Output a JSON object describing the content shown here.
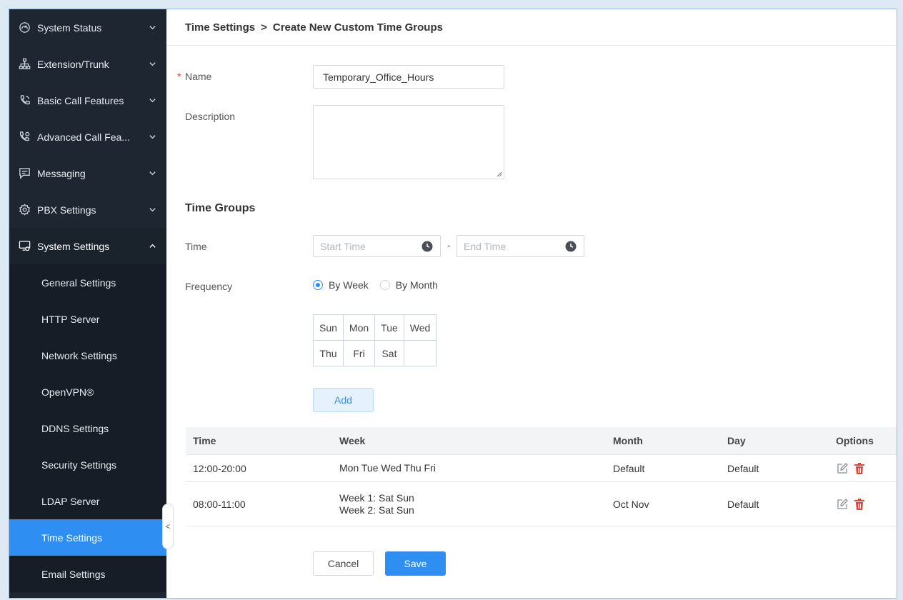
{
  "sidebar": {
    "items": [
      {
        "label": "System Status",
        "icon": "gauge-icon",
        "expanded": false
      },
      {
        "label": "Extension/Trunk",
        "icon": "network-icon",
        "expanded": false
      },
      {
        "label": "Basic Call Features",
        "icon": "phone-icon",
        "expanded": false
      },
      {
        "label": "Advanced Call Fea...",
        "icon": "phone-advanced-icon",
        "expanded": false
      },
      {
        "label": "Messaging",
        "icon": "message-icon",
        "expanded": false
      },
      {
        "label": "PBX Settings",
        "icon": "gear-icon",
        "expanded": false
      },
      {
        "label": "System Settings",
        "icon": "monitor-settings-icon",
        "expanded": true
      }
    ],
    "sub_items": [
      {
        "label": "General Settings"
      },
      {
        "label": "HTTP Server"
      },
      {
        "label": "Network Settings"
      },
      {
        "label": "OpenVPN®"
      },
      {
        "label": "DDNS Settings"
      },
      {
        "label": "Security Settings"
      },
      {
        "label": "LDAP Server"
      },
      {
        "label": "Time Settings",
        "selected": true
      },
      {
        "label": "Email Settings"
      }
    ],
    "collapse_glyph": "<"
  },
  "breadcrumb": {
    "parent": "Time Settings",
    "separator": ">",
    "current": "Create New Custom Time Groups"
  },
  "form": {
    "name_label": "Name",
    "name_required_mark": "*",
    "name_value": "Temporary_Office_Hours",
    "description_label": "Description",
    "description_value": "",
    "section_title": "Time Groups",
    "time_label": "Time",
    "start_time_placeholder": "Start Time",
    "time_separator": "-",
    "end_time_placeholder": "End Time",
    "frequency_label": "Frequency",
    "frequency_options": [
      {
        "label": "By Week",
        "selected": true
      },
      {
        "label": "By Month",
        "selected": false
      }
    ],
    "days": [
      [
        "Sun",
        "Mon",
        "Tue",
        "Wed"
      ],
      [
        "Thu",
        "Fri",
        "Sat",
        ""
      ]
    ],
    "add_label": "Add"
  },
  "table": {
    "headers": [
      "Time",
      "Week",
      "Month",
      "Day",
      "Options"
    ],
    "rows": [
      {
        "time": "12:00-20:00",
        "week": [
          "Mon Tue Wed Thu Fri"
        ],
        "month": "Default",
        "day": "Default"
      },
      {
        "time": "08:00-11:00",
        "week": [
          "Week 1: Sat Sun",
          "Week 2: Sat Sun"
        ],
        "month": "Oct Nov",
        "day": "Default"
      }
    ]
  },
  "actions": {
    "cancel_label": "Cancel",
    "save_label": "Save"
  },
  "colors": {
    "sidebar_bg": "#1d2631",
    "accent": "#2f8ef2",
    "delete": "#e6423b"
  }
}
